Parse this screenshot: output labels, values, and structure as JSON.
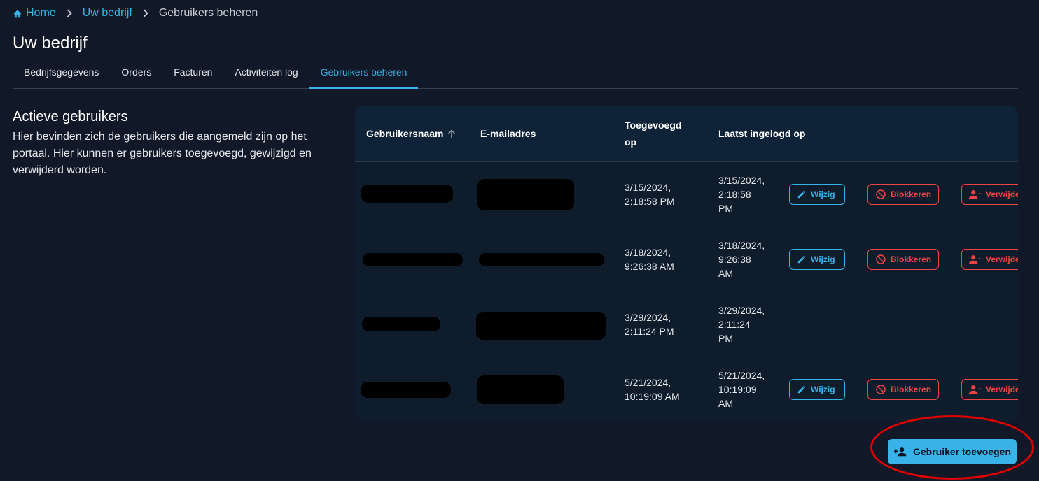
{
  "breadcrumb": {
    "home": "Home",
    "company": "Uw bedrijf",
    "current": "Gebruikers beheren"
  },
  "page_title": "Uw bedrijf",
  "tabs": [
    {
      "label": "Bedrijfsgegevens",
      "active": false
    },
    {
      "label": "Orders",
      "active": false
    },
    {
      "label": "Facturen",
      "active": false
    },
    {
      "label": "Activiteiten log",
      "active": false
    },
    {
      "label": "Gebruikers beheren",
      "active": true
    }
  ],
  "section": {
    "title": "Actieve gebruikers",
    "description": "Hier bevinden zich de gebruikers die aangemeld zijn op het portaal. Hier kunnen er gebruikers toegevoegd, gewijzigd en verwijderd worden."
  },
  "table": {
    "columns": {
      "username": "Gebruikersnaam",
      "email": "E-mailadres",
      "added_line1": "Toegevoegd",
      "added_line2": "op",
      "last_login": "Laatst ingelogd op"
    },
    "sort": {
      "column": "Gebruikersnaam",
      "direction": "ascending",
      "icon": "arrow-up-icon"
    },
    "rows": [
      {
        "added_date": "3/15/2024,",
        "added_time": "2:18:58 PM",
        "login_l1": "3/15/2024,",
        "login_l2": "2:18:58",
        "login_l3": "PM",
        "actions": true
      },
      {
        "added_date": "3/18/2024,",
        "added_time": "9:26:38 AM",
        "login_l1": "3/18/2024,",
        "login_l2": "9:26:38",
        "login_l3": "AM",
        "actions": true
      },
      {
        "added_date": "3/29/2024,",
        "added_time": "2:11:24 PM",
        "login_l1": "3/29/2024,",
        "login_l2": "2:11:24",
        "login_l3": "PM",
        "actions": false
      },
      {
        "added_date": "5/21/2024,",
        "added_time": "10:19:09 AM",
        "login_l1": "5/21/2024,",
        "login_l2": "10:19:09",
        "login_l3": "AM",
        "actions": true
      }
    ],
    "action_labels": {
      "edit": "Wijzig",
      "block": "Blokkeren",
      "delete": "Verwijde"
    }
  },
  "add_user_button": "Gebruiker toevoegen",
  "colors": {
    "background": "#111827",
    "accent": "#38b2e8",
    "danger": "#ef4444",
    "highlight": "#e00000"
  },
  "icons": [
    "home-icon",
    "chevron-right-icon",
    "arrow-up-icon",
    "pencil-icon",
    "block-icon",
    "person-remove-icon",
    "person-add-icon"
  ]
}
